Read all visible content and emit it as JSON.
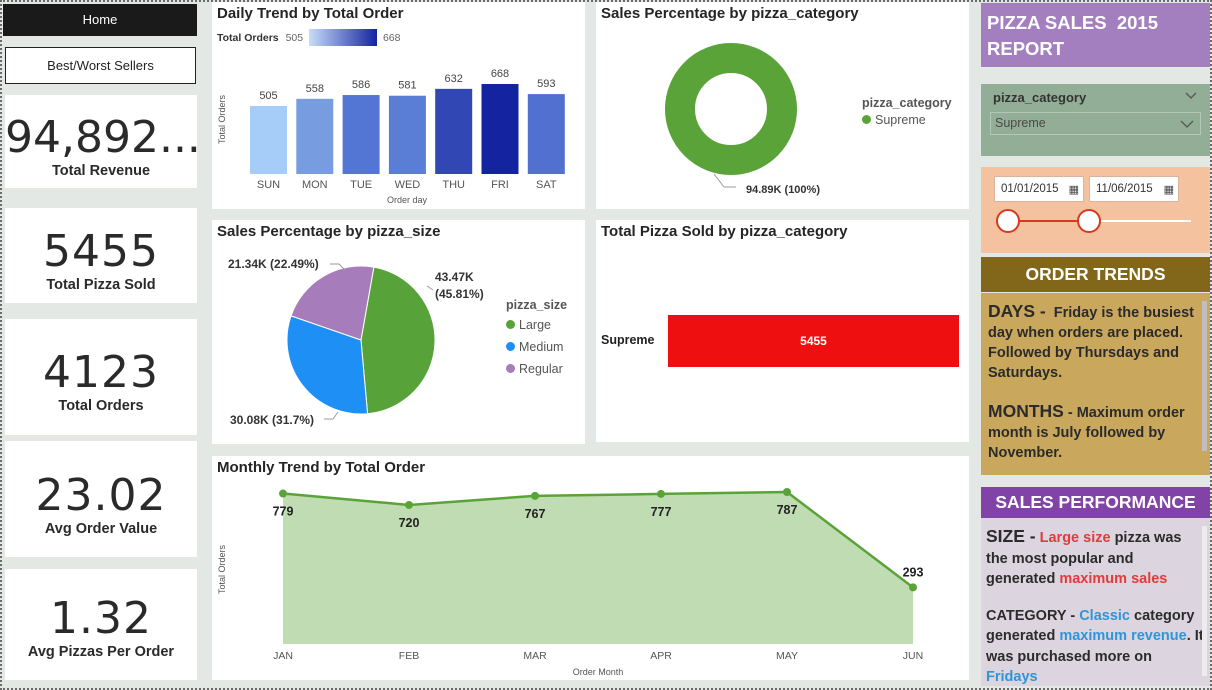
{
  "nav": {
    "home_label": "Home",
    "bestworst_label": "Best/Worst Sellers"
  },
  "kpis": {
    "total_revenue": {
      "value": "94,892...",
      "label": "Total Revenue"
    },
    "total_pizza_sold": {
      "value": "5455",
      "label": "Total Pizza Sold"
    },
    "total_orders": {
      "value": "4123",
      "label": "Total Orders"
    },
    "avg_order_value": {
      "value": "23.02",
      "label": "Avg Order Value"
    },
    "avg_pizzas_per_order": {
      "value": "1.32",
      "label": "Avg Pizzas Per Order"
    }
  },
  "daily_chart": {
    "title": "Daily Trend by Total Order",
    "legend_label": "Total Orders",
    "gradient_min": "505",
    "gradient_max": "668"
  },
  "category_donut": {
    "title": "Sales Percentage by pizza_category",
    "legend_title": "pizza_category",
    "legend_item": "Supreme",
    "data_label": "94.89K (100%)"
  },
  "size_pie": {
    "title": "Sales Percentage by pizza_size",
    "legend_title": "pizza_size"
  },
  "category_bar": {
    "title": "Total Pizza Sold by pizza_category"
  },
  "monthly_chart": {
    "title": "Monthly Trend by Total Order"
  },
  "chart_data": [
    {
      "type": "bar",
      "title": "Daily Trend by Total Order",
      "xlabel": "Order day",
      "ylabel": "Total Orders",
      "categories": [
        "SUN",
        "MON",
        "TUE",
        "WED",
        "THU",
        "FRI",
        "SAT"
      ],
      "values": [
        505,
        558,
        586,
        581,
        632,
        668,
        593
      ],
      "colors": [
        "#a6cdf7",
        "#779de0",
        "#5376d4",
        "#5a7ed6",
        "#3047b4",
        "#1424a0",
        "#5270cf"
      ]
    },
    {
      "type": "pie",
      "title": "Sales Percentage by pizza_category",
      "slices": [
        {
          "label": "Supreme",
          "value": 94.89,
          "display": "94.89K (100%)",
          "color": "#5aa339"
        }
      ]
    },
    {
      "type": "pie",
      "title": "Sales Percentage by pizza_size",
      "slices": [
        {
          "label": "Large",
          "value": 45.81,
          "display_value": "43.47K",
          "display_pct": "(45.81%)",
          "color": "#57a33a"
        },
        {
          "label": "Medium",
          "value": 31.7,
          "display": "30.08K (31.7%)",
          "color": "#1e90f5"
        },
        {
          "label": "Regular",
          "value": 22.49,
          "display": "21.34K (22.49%)",
          "color": "#a67cbb"
        }
      ]
    },
    {
      "type": "bar",
      "title": "Total Pizza Sold by pizza_category",
      "categories": [
        "Supreme"
      ],
      "values": [
        5455
      ],
      "color": "#ee1010"
    },
    {
      "type": "area",
      "title": "Monthly Trend by Total Order",
      "xlabel": "Order Month",
      "ylabel": "Total Orders",
      "categories": [
        "JAN",
        "FEB",
        "MAR",
        "APR",
        "MAY",
        "JUN"
      ],
      "values": [
        779,
        720,
        767,
        777,
        787,
        293
      ],
      "color": "#5aa339",
      "fill": "#c0dcb2"
    }
  ],
  "report": {
    "title_line1": "PIZZA SALES  2015",
    "title_line2": "REPORT"
  },
  "slicer": {
    "title": "pizza_category",
    "selected": "Supreme"
  },
  "date_range": {
    "start": "01/01/2015",
    "end": "11/06/2015"
  },
  "order_trends": {
    "heading": "ORDER TRENDS",
    "days_label": "DAYS -",
    "days_text": "Friday is the busiest day when orders are placed. Followed by Thursdays and Saturdays.",
    "months_label": "MONTHS",
    "months_text": "- Maximum order month is  July followed by November."
  },
  "sales_performance": {
    "heading": "SALES PERFORMANCE",
    "size_label": "SIZE -",
    "size_highlight": "Large size",
    "size_text1": "pizza was the most popular and generated",
    "size_highlight2": "maximum sales",
    "category_label": "CATEGORY -",
    "category_highlight": "Classic",
    "category_text1": "category generated",
    "category_highlight2": "maximum revenue",
    "category_text2": ". It was purchased more on",
    "category_highlight3": "Fridays"
  },
  "colors": {
    "accent_purple": "#a37fc0",
    "accent_gold": "#82661a",
    "accent_green": "#5aa339",
    "accent_red": "#ee1010"
  }
}
